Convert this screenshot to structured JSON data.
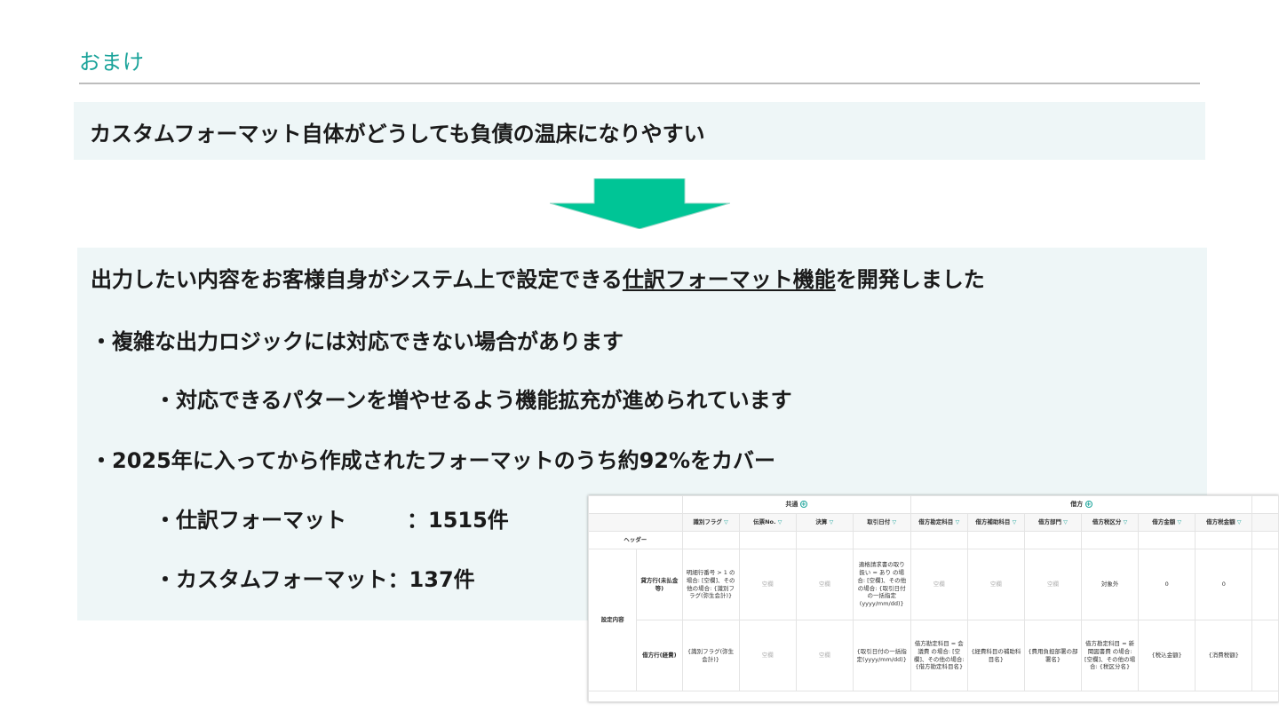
{
  "slide": {
    "title": "おまけ",
    "problem": "カスタムフォーマット自体がどうしても負債の温床になりやすい",
    "arrow_color": "#00c596",
    "solution_pre": "出力したい内容をお客様自身がシステム上で設定できる",
    "solution_link": "仕訳フォーマット機能",
    "solution_post": "を開発しました",
    "bullet1": "・複雑な出力ロジックには対応できない場合があります",
    "bullet1_sub": "・対応できるパターンを増やせるよう機能拡充が進められています",
    "bullet2": "・2025年に入ってから作成されたフォーマットのうち約92%をカバー",
    "stat1_label": "・仕訳フォーマット",
    "stat1_value": "：1515件",
    "stat2_label": "・カスタムフォーマット",
    "stat2_value": "：137件"
  },
  "table": {
    "group_common": "共通",
    "group_debit": "借方",
    "headers": [
      "識別フラグ",
      "伝票No.",
      "決算",
      "取引日付",
      "借方勘定科目",
      "借方補助科目",
      "借方部門",
      "借方税区分",
      "借方金額",
      "借方税金額"
    ],
    "header_row_label": "ヘッダー",
    "section_label": "設定内容",
    "row1_label": "貸方行(未払金等)",
    "row2_label": "借方行(経費)",
    "row1": [
      "明細行番号 > 1 の場合: [空欄]、その他の場合: {識別フラグ(弥生会計)}",
      "空欄",
      "空欄",
      "適格請求書の取り扱い = あり の場合: [空欄]、その他の場合: {取引日付の一括指定(yyyy/mm/dd)}",
      "空欄",
      "空欄",
      "空欄",
      "対象外",
      "0",
      "0"
    ],
    "row2": [
      "{識別フラグ(弥生会計)}",
      "空欄",
      "空欄",
      "{取引日付の一括指定(yyyy/mm/dd)}",
      "借方勘定科目 = 会議費 の場合: [空欄]、その他の場合: {借方勘定科目名}",
      "{経費科目の補助科目名}",
      "{費用負担部署の部署名}",
      "借方勘定科目 = 新聞図書費 の場合: [空欄]、その他の場合: {税区分名}",
      "{税込金額}",
      "{消費税額}"
    ]
  }
}
